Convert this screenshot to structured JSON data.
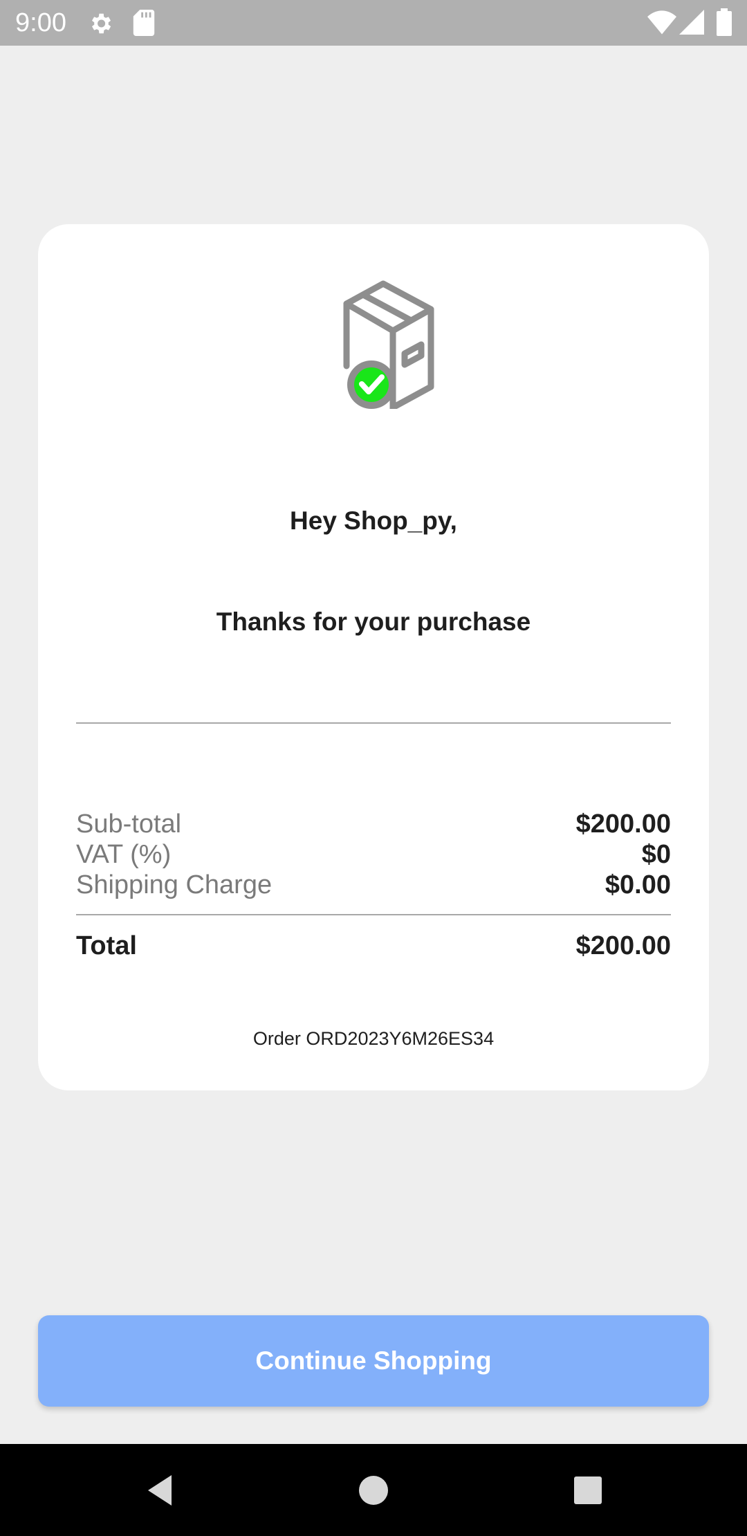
{
  "status_bar": {
    "time": "9:00",
    "icons": [
      "gear-icon",
      "sd-card-icon",
      "wifi-icon",
      "signal-icon",
      "battery-icon"
    ]
  },
  "card": {
    "icon": "package-delivered-icon",
    "greeting": "Hey Shop_py,",
    "thanks": "Thanks for your purchase",
    "summary": {
      "subtotal_label": "Sub-total",
      "subtotal_value": "$200.00",
      "vat_label": "VAT (%)",
      "vat_value": "$0",
      "shipping_label": "Shipping Charge",
      "shipping_value": "$0.00",
      "total_label": "Total",
      "total_value": "$200.00"
    },
    "order_id": "Order ORD2023Y6M26ES34"
  },
  "continue_button": {
    "label": "Continue Shopping"
  },
  "nav_bar": {
    "icons": [
      "back-icon",
      "home-icon",
      "recents-icon"
    ]
  },
  "colors": {
    "background": "#eeeeee",
    "card": "#ffffff",
    "button": "#83b0fa",
    "check": "#19e619",
    "icon_gray": "#8e8e8e"
  }
}
